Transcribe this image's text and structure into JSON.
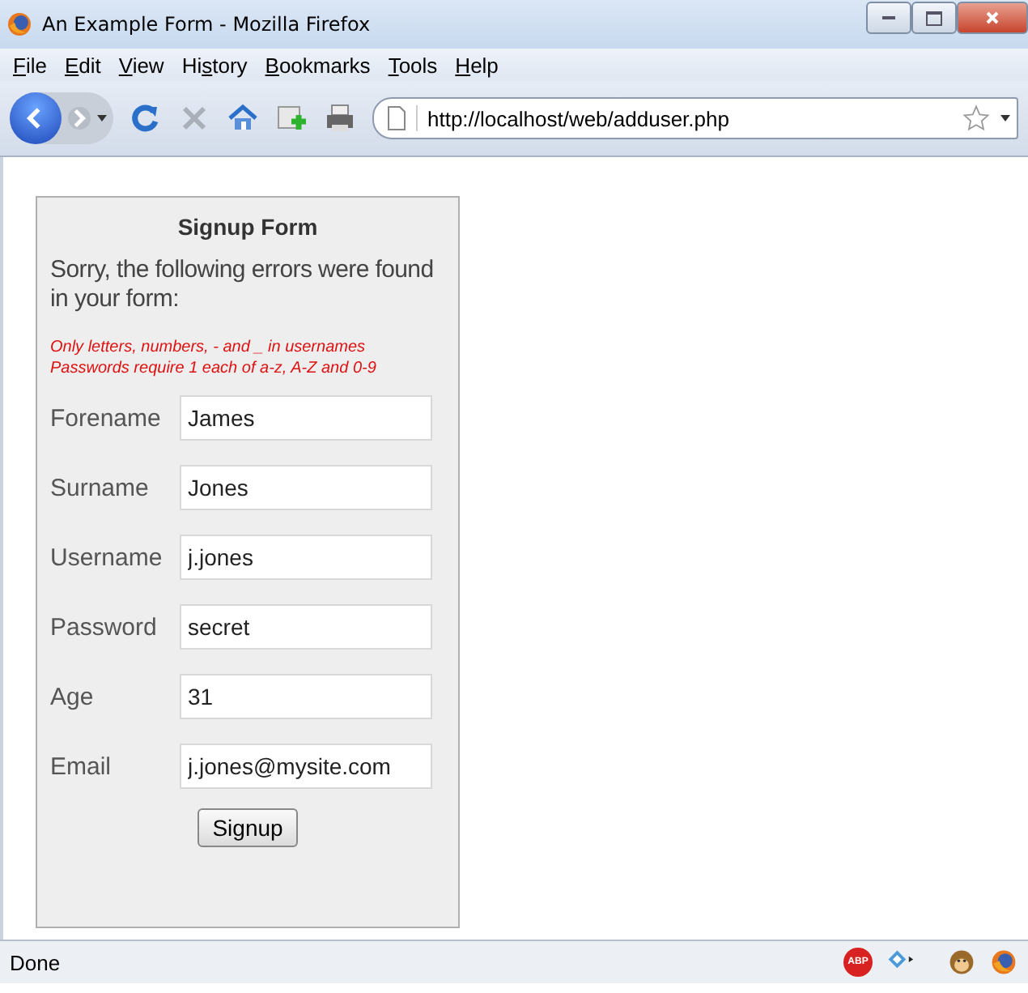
{
  "window": {
    "title": "An Example Form - Mozilla Firefox"
  },
  "menu": [
    {
      "key": "F",
      "after": "ile"
    },
    {
      "key": "E",
      "after": "dit"
    },
    {
      "key": "V",
      "after": "iew"
    },
    {
      "before": "Hi",
      "key": "s",
      "after": "tory"
    },
    {
      "key": "B",
      "after": "ookmarks"
    },
    {
      "key": "T",
      "after": "ools"
    },
    {
      "key": "H",
      "after": "elp"
    }
  ],
  "address": {
    "value": "http://localhost/web/adduser.php"
  },
  "form": {
    "title": "Signup Form",
    "message": "Sorry, the following errors were found in your form:",
    "errors": [
      "Only letters, numbers, - and _ in usernames",
      "Passwords require 1 each of a-z, A-Z and 0-9"
    ],
    "fields": [
      {
        "label": "Forename",
        "value": "James"
      },
      {
        "label": "Surname",
        "value": "Jones"
      },
      {
        "label": "Username",
        "value": "j.jones"
      },
      {
        "label": "Password",
        "value": "secret"
      },
      {
        "label": "Age",
        "value": "31"
      },
      {
        "label": "Email",
        "value": "j.jones@mysite.com"
      }
    ],
    "submit": "Signup"
  },
  "status_bar": {
    "text": "Done",
    "adblock_label": "ABP"
  }
}
